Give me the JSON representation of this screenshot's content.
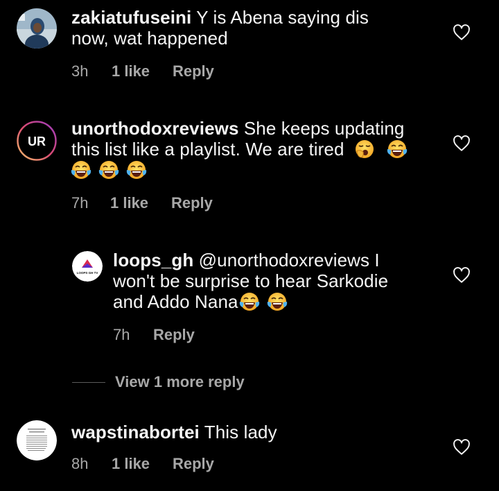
{
  "comments": [
    {
      "username": "zakiatufuseini",
      "line1": " Y is Abena saying dis",
      "line2": "now, wat happened",
      "time": "3h",
      "likes": "1 like",
      "reply": "Reply"
    },
    {
      "username": "unorthodoxreviews",
      "line1": " She keeps updating",
      "line2": "this list like a playlist. We are tired",
      "time": "7h",
      "likes": "1 like",
      "reply": "Reply",
      "avatar_text": "UR"
    },
    {
      "username": "wapstinabortei",
      "line1": " This lady",
      "time": "8h",
      "likes": "1 like",
      "reply": "Reply"
    }
  ],
  "reply": {
    "username": "loops_gh",
    "line1": " @unorthodoxreviews I",
    "line2": "won't be surprise to hear Sarkodie",
    "line3": "and Addo Nana",
    "time": "7h",
    "reply": "Reply",
    "avatar_text": "LOOPS GH TV"
  },
  "view_more": "View 1 more reply",
  "icons": {
    "heart": "heart-outline-icon",
    "laugh": "face-with-tears-of-joy-icon",
    "yawn": "yawning-face-icon"
  },
  "colors": {
    "background": "#000000",
    "text": "#f5f5f5",
    "meta": "#a8a8a8"
  }
}
